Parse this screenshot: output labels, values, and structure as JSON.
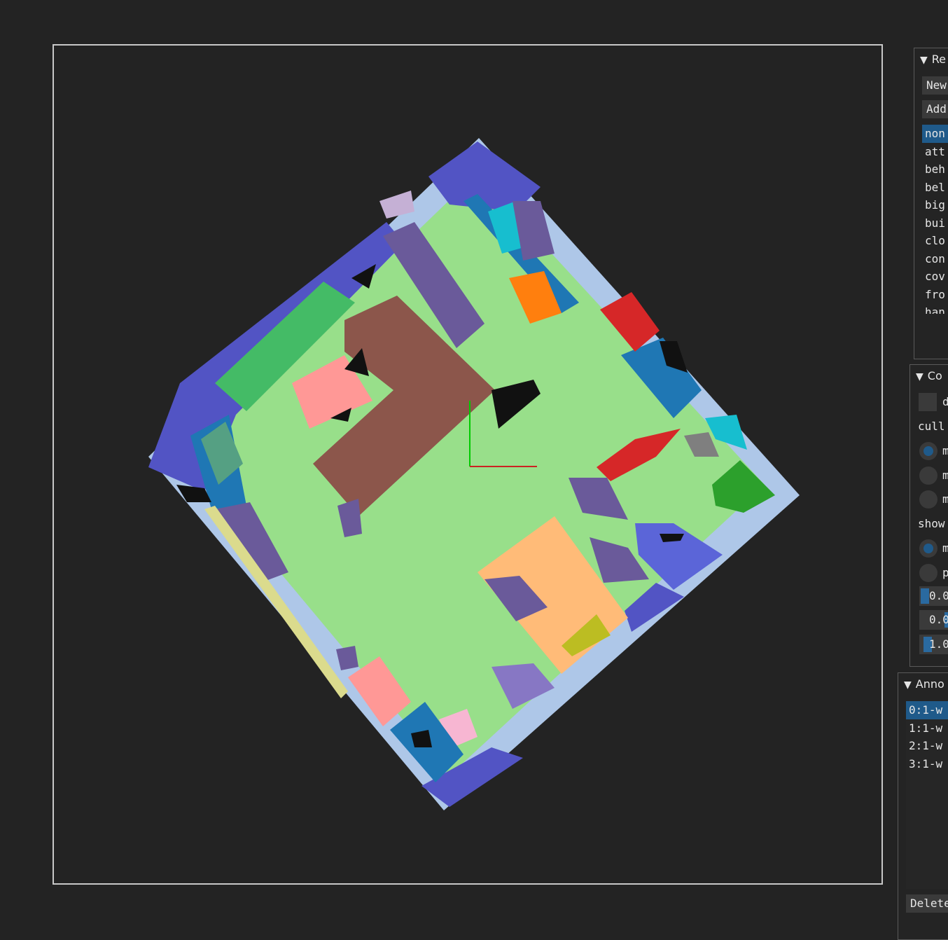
{
  "panels": {
    "region": {
      "title": "Re",
      "buttons": [
        "New",
        "Add"
      ],
      "items": [
        "non",
        "att",
        "beh",
        "bel",
        "big",
        "bui",
        "clo",
        "con",
        "cov",
        "fro",
        "han"
      ],
      "selected_index": 0
    },
    "config": {
      "title": "Co",
      "checkbox_label": "d",
      "culling_label": "cull",
      "culling_options": [
        "m",
        "m",
        "m"
      ],
      "show_label": "show",
      "show_options": [
        "m",
        "p"
      ],
      "sliders": [
        "0.0",
        "0.0",
        "1.0"
      ],
      "slider_fractions": [
        0.0,
        0.6,
        0.1
      ]
    },
    "annotations": {
      "title": "Anno",
      "items": [
        "0:1-w",
        "1:1-w",
        "2:1-w",
        "3:1-w"
      ],
      "selected_index": 0,
      "delete_label": "Delete"
    }
  },
  "colors": {
    "background": "#232323",
    "floor": "#98df8a",
    "wall_edge": "#aec7e8",
    "selection": "#1f5a8a"
  }
}
